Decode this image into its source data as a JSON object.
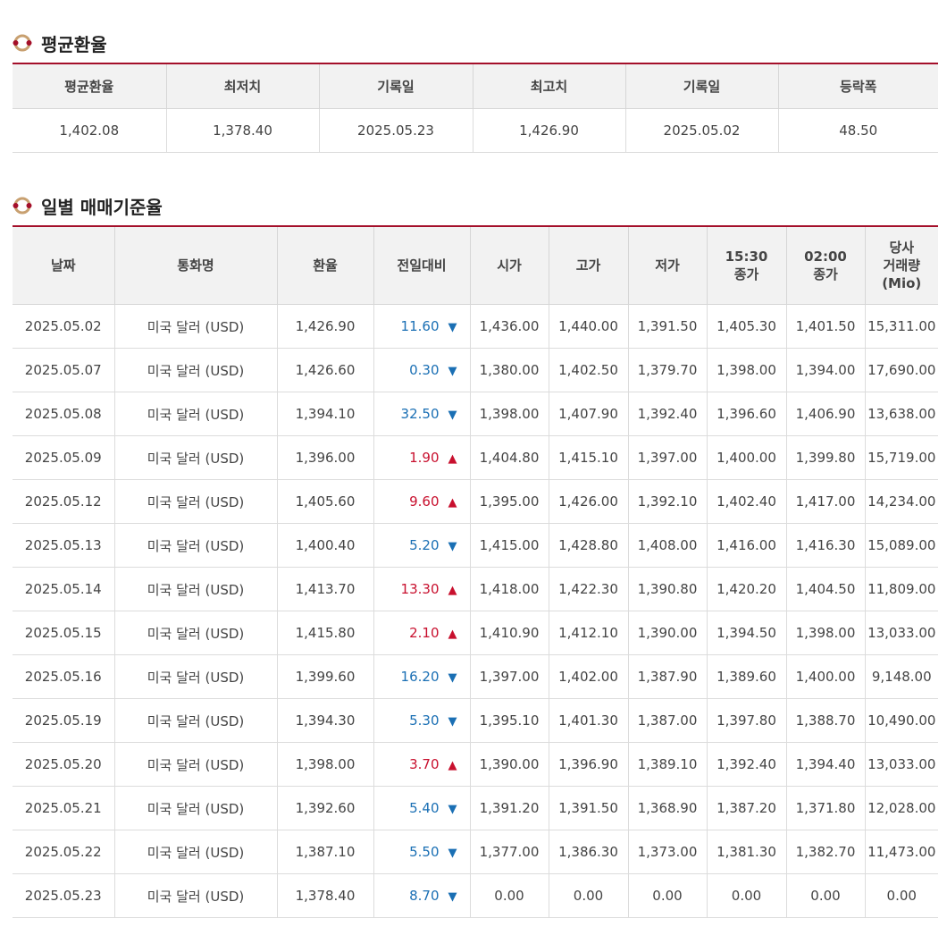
{
  "avg_section": {
    "title": "평균환율",
    "headers": [
      "평균환율",
      "최저치",
      "기록일",
      "최고치",
      "기록일",
      "등락폭"
    ],
    "row": [
      "1,402.08",
      "1,378.40",
      "2025.05.23",
      "1,426.90",
      "2025.05.02",
      "48.50"
    ]
  },
  "daily_section": {
    "title": "일별 매매기준율",
    "headers": [
      "날짜",
      "통화명",
      "환율",
      "전일대비",
      "시가",
      "고가",
      "저가",
      "15:30\n종가",
      "02:00\n종가",
      "당사\n거래량\n(Mio)"
    ],
    "rows": [
      {
        "date": "2025.05.02",
        "currency": "미국 달러 (USD)",
        "rate": "1,426.90",
        "diff": "11.60",
        "dir": "down",
        "open": "1,436.00",
        "high": "1,440.00",
        "low": "1,391.50",
        "close1530": "1,405.30",
        "close0200": "1,401.50",
        "volume": "15,311.00"
      },
      {
        "date": "2025.05.07",
        "currency": "미국 달러 (USD)",
        "rate": "1,426.60",
        "diff": "0.30",
        "dir": "down",
        "open": "1,380.00",
        "high": "1,402.50",
        "low": "1,379.70",
        "close1530": "1,398.00",
        "close0200": "1,394.00",
        "volume": "17,690.00"
      },
      {
        "date": "2025.05.08",
        "currency": "미국 달러 (USD)",
        "rate": "1,394.10",
        "diff": "32.50",
        "dir": "down",
        "open": "1,398.00",
        "high": "1,407.90",
        "low": "1,392.40",
        "close1530": "1,396.60",
        "close0200": "1,406.90",
        "volume": "13,638.00"
      },
      {
        "date": "2025.05.09",
        "currency": "미국 달러 (USD)",
        "rate": "1,396.00",
        "diff": "1.90",
        "dir": "up",
        "open": "1,404.80",
        "high": "1,415.10",
        "low": "1,397.00",
        "close1530": "1,400.00",
        "close0200": "1,399.80",
        "volume": "15,719.00"
      },
      {
        "date": "2025.05.12",
        "currency": "미국 달러 (USD)",
        "rate": "1,405.60",
        "diff": "9.60",
        "dir": "up",
        "open": "1,395.00",
        "high": "1,426.00",
        "low": "1,392.10",
        "close1530": "1,402.40",
        "close0200": "1,417.00",
        "volume": "14,234.00"
      },
      {
        "date": "2025.05.13",
        "currency": "미국 달러 (USD)",
        "rate": "1,400.40",
        "diff": "5.20",
        "dir": "down",
        "open": "1,415.00",
        "high": "1,428.80",
        "low": "1,408.00",
        "close1530": "1,416.00",
        "close0200": "1,416.30",
        "volume": "15,089.00"
      },
      {
        "date": "2025.05.14",
        "currency": "미국 달러 (USD)",
        "rate": "1,413.70",
        "diff": "13.30",
        "dir": "up",
        "open": "1,418.00",
        "high": "1,422.30",
        "low": "1,390.80",
        "close1530": "1,420.20",
        "close0200": "1,404.50",
        "volume": "11,809.00"
      },
      {
        "date": "2025.05.15",
        "currency": "미국 달러 (USD)",
        "rate": "1,415.80",
        "diff": "2.10",
        "dir": "up",
        "open": "1,410.90",
        "high": "1,412.10",
        "low": "1,390.00",
        "close1530": "1,394.50",
        "close0200": "1,398.00",
        "volume": "13,033.00"
      },
      {
        "date": "2025.05.16",
        "currency": "미국 달러 (USD)",
        "rate": "1,399.60",
        "diff": "16.20",
        "dir": "down",
        "open": "1,397.00",
        "high": "1,402.00",
        "low": "1,387.90",
        "close1530": "1,389.60",
        "close0200": "1,400.00",
        "volume": "9,148.00"
      },
      {
        "date": "2025.05.19",
        "currency": "미국 달러 (USD)",
        "rate": "1,394.30",
        "diff": "5.30",
        "dir": "down",
        "open": "1,395.10",
        "high": "1,401.30",
        "low": "1,387.00",
        "close1530": "1,397.80",
        "close0200": "1,388.70",
        "volume": "10,490.00"
      },
      {
        "date": "2025.05.20",
        "currency": "미국 달러 (USD)",
        "rate": "1,398.00",
        "diff": "3.70",
        "dir": "up",
        "open": "1,390.00",
        "high": "1,396.90",
        "low": "1,389.10",
        "close1530": "1,392.40",
        "close0200": "1,394.40",
        "volume": "13,033.00"
      },
      {
        "date": "2025.05.21",
        "currency": "미국 달러 (USD)",
        "rate": "1,392.60",
        "diff": "5.40",
        "dir": "down",
        "open": "1,391.20",
        "high": "1,391.50",
        "low": "1,368.90",
        "close1530": "1,387.20",
        "close0200": "1,371.80",
        "volume": "12,028.00"
      },
      {
        "date": "2025.05.22",
        "currency": "미국 달러 (USD)",
        "rate": "1,387.10",
        "diff": "5.50",
        "dir": "down",
        "open": "1,377.00",
        "high": "1,386.30",
        "low": "1,373.00",
        "close1530": "1,381.30",
        "close0200": "1,382.70",
        "volume": "11,473.00"
      },
      {
        "date": "2025.05.23",
        "currency": "미국 달러 (USD)",
        "rate": "1,378.40",
        "diff": "8.70",
        "dir": "down",
        "open": "0.00",
        "high": "0.00",
        "low": "0.00",
        "close1530": "0.00",
        "close0200": "0.00",
        "volume": "0.00"
      }
    ]
  },
  "icons": {
    "section_icon": "rings-icon",
    "up_arrow": "triangle-up-icon",
    "down_arrow": "triangle-down-icon"
  },
  "colors": {
    "accent": "#a40f2a",
    "up": "#c8102e",
    "down": "#1a6fb4",
    "icon_gold": "#c8a070"
  }
}
